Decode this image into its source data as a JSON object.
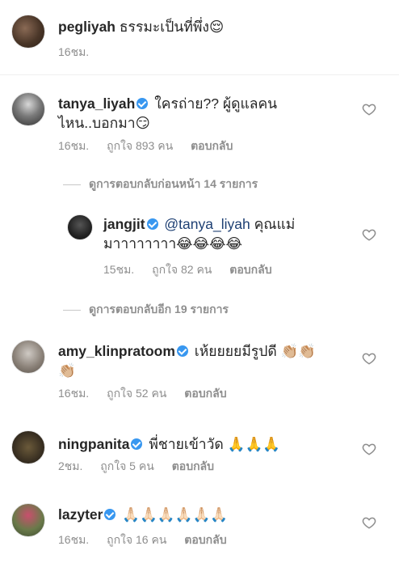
{
  "post": {
    "username": "pegliyah",
    "caption": "ธรรมะเป็นที่พึ่ง😌",
    "time": "16ชม."
  },
  "comments": [
    {
      "username": "tanya_liyah",
      "verified": true,
      "text": "ใครถ่าย?? ผู้ดูแลคน",
      "text2": "ไหน..บอกมา😏",
      "time": "16ชม.",
      "likes": "ถูกใจ 893 คน",
      "reply": "ตอบกลับ"
    },
    {
      "username": "jangjit",
      "verified": true,
      "mention": "@tanya_liyah",
      "text": " คุณแม่",
      "text2": "มาาาาาาาา😂😂😂😂",
      "time": "15ชม.",
      "likes": "ถูกใจ 82 คน",
      "reply": "ตอบกลับ"
    },
    {
      "username": "amy_klinpratoom",
      "verified": true,
      "text": " เห้ยยยยมีรูปดี 👏🏼👏🏼",
      "text2": "👏🏼",
      "time": "16ชม.",
      "likes": "ถูกใจ 52 คน",
      "reply": "ตอบกลับ"
    },
    {
      "username": "ningpanita",
      "verified": true,
      "text": " พี่ชายเข้าวัด 🙏🙏🙏",
      "time": "2ชม.",
      "likes": "ถูกใจ 5 คน",
      "reply": "ตอบกลับ"
    },
    {
      "username": "lazyter",
      "verified": true,
      "text": " 🙏🏻🙏🏻🙏🏻🙏🏻🙏🏻🙏🏻",
      "time": "16ชม.",
      "likes": "ถูกใจ 16 คน",
      "reply": "ตอบกลับ"
    }
  ],
  "view_previous": "ดูการตอบกลับก่อนหน้า 14 รายการ",
  "view_more": "ดูการตอบกลับอีก 19 รายการ",
  "colors": {
    "verified": "#3897f0",
    "mention": "#1d3f73",
    "meta": "#8e8e8e"
  }
}
